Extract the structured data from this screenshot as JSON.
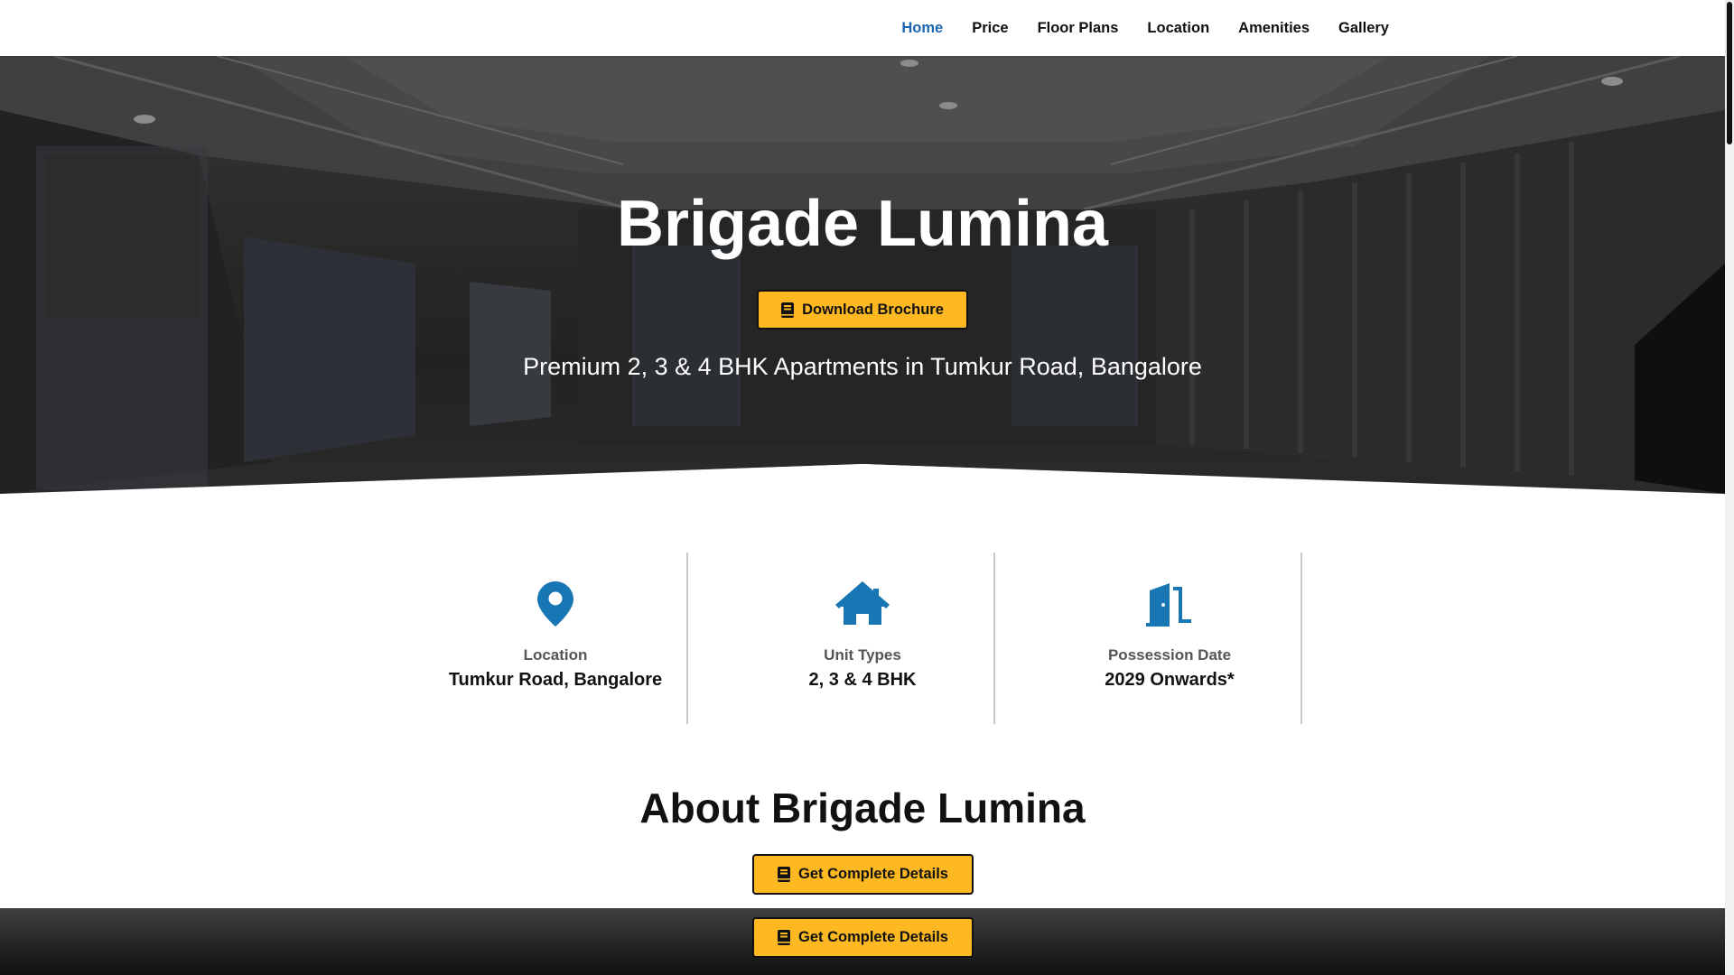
{
  "nav": {
    "items": [
      {
        "label": "Home",
        "active": true
      },
      {
        "label": "Price"
      },
      {
        "label": "Floor Plans"
      },
      {
        "label": "Location"
      },
      {
        "label": "Amenities"
      },
      {
        "label": "Gallery"
      }
    ]
  },
  "hero": {
    "title": "Brigade Lumina",
    "button_label": "Download Brochure",
    "subtitle": "Premium 2, 3 & 4 BHK Apartments in Tumkur Road, Bangalore"
  },
  "info": [
    {
      "icon": "map-pin-icon",
      "label": "Location",
      "value": "Tumkur Road, Bangalore"
    },
    {
      "icon": "home-icon",
      "label": "Unit Types",
      "value": "2, 3 & 4 BHK"
    },
    {
      "icon": "door-open-icon",
      "label": "Possession Date",
      "value": "2029 Onwards*"
    }
  ],
  "about": {
    "title": "About Brigade Lumina",
    "button_label": "Get Complete Details"
  },
  "sticky_bar": {
    "button_label": "Get Complete Details"
  },
  "colors": {
    "accent": "#fdb822",
    "nav_active": "#1a67b1",
    "icon": "#1776b3"
  }
}
